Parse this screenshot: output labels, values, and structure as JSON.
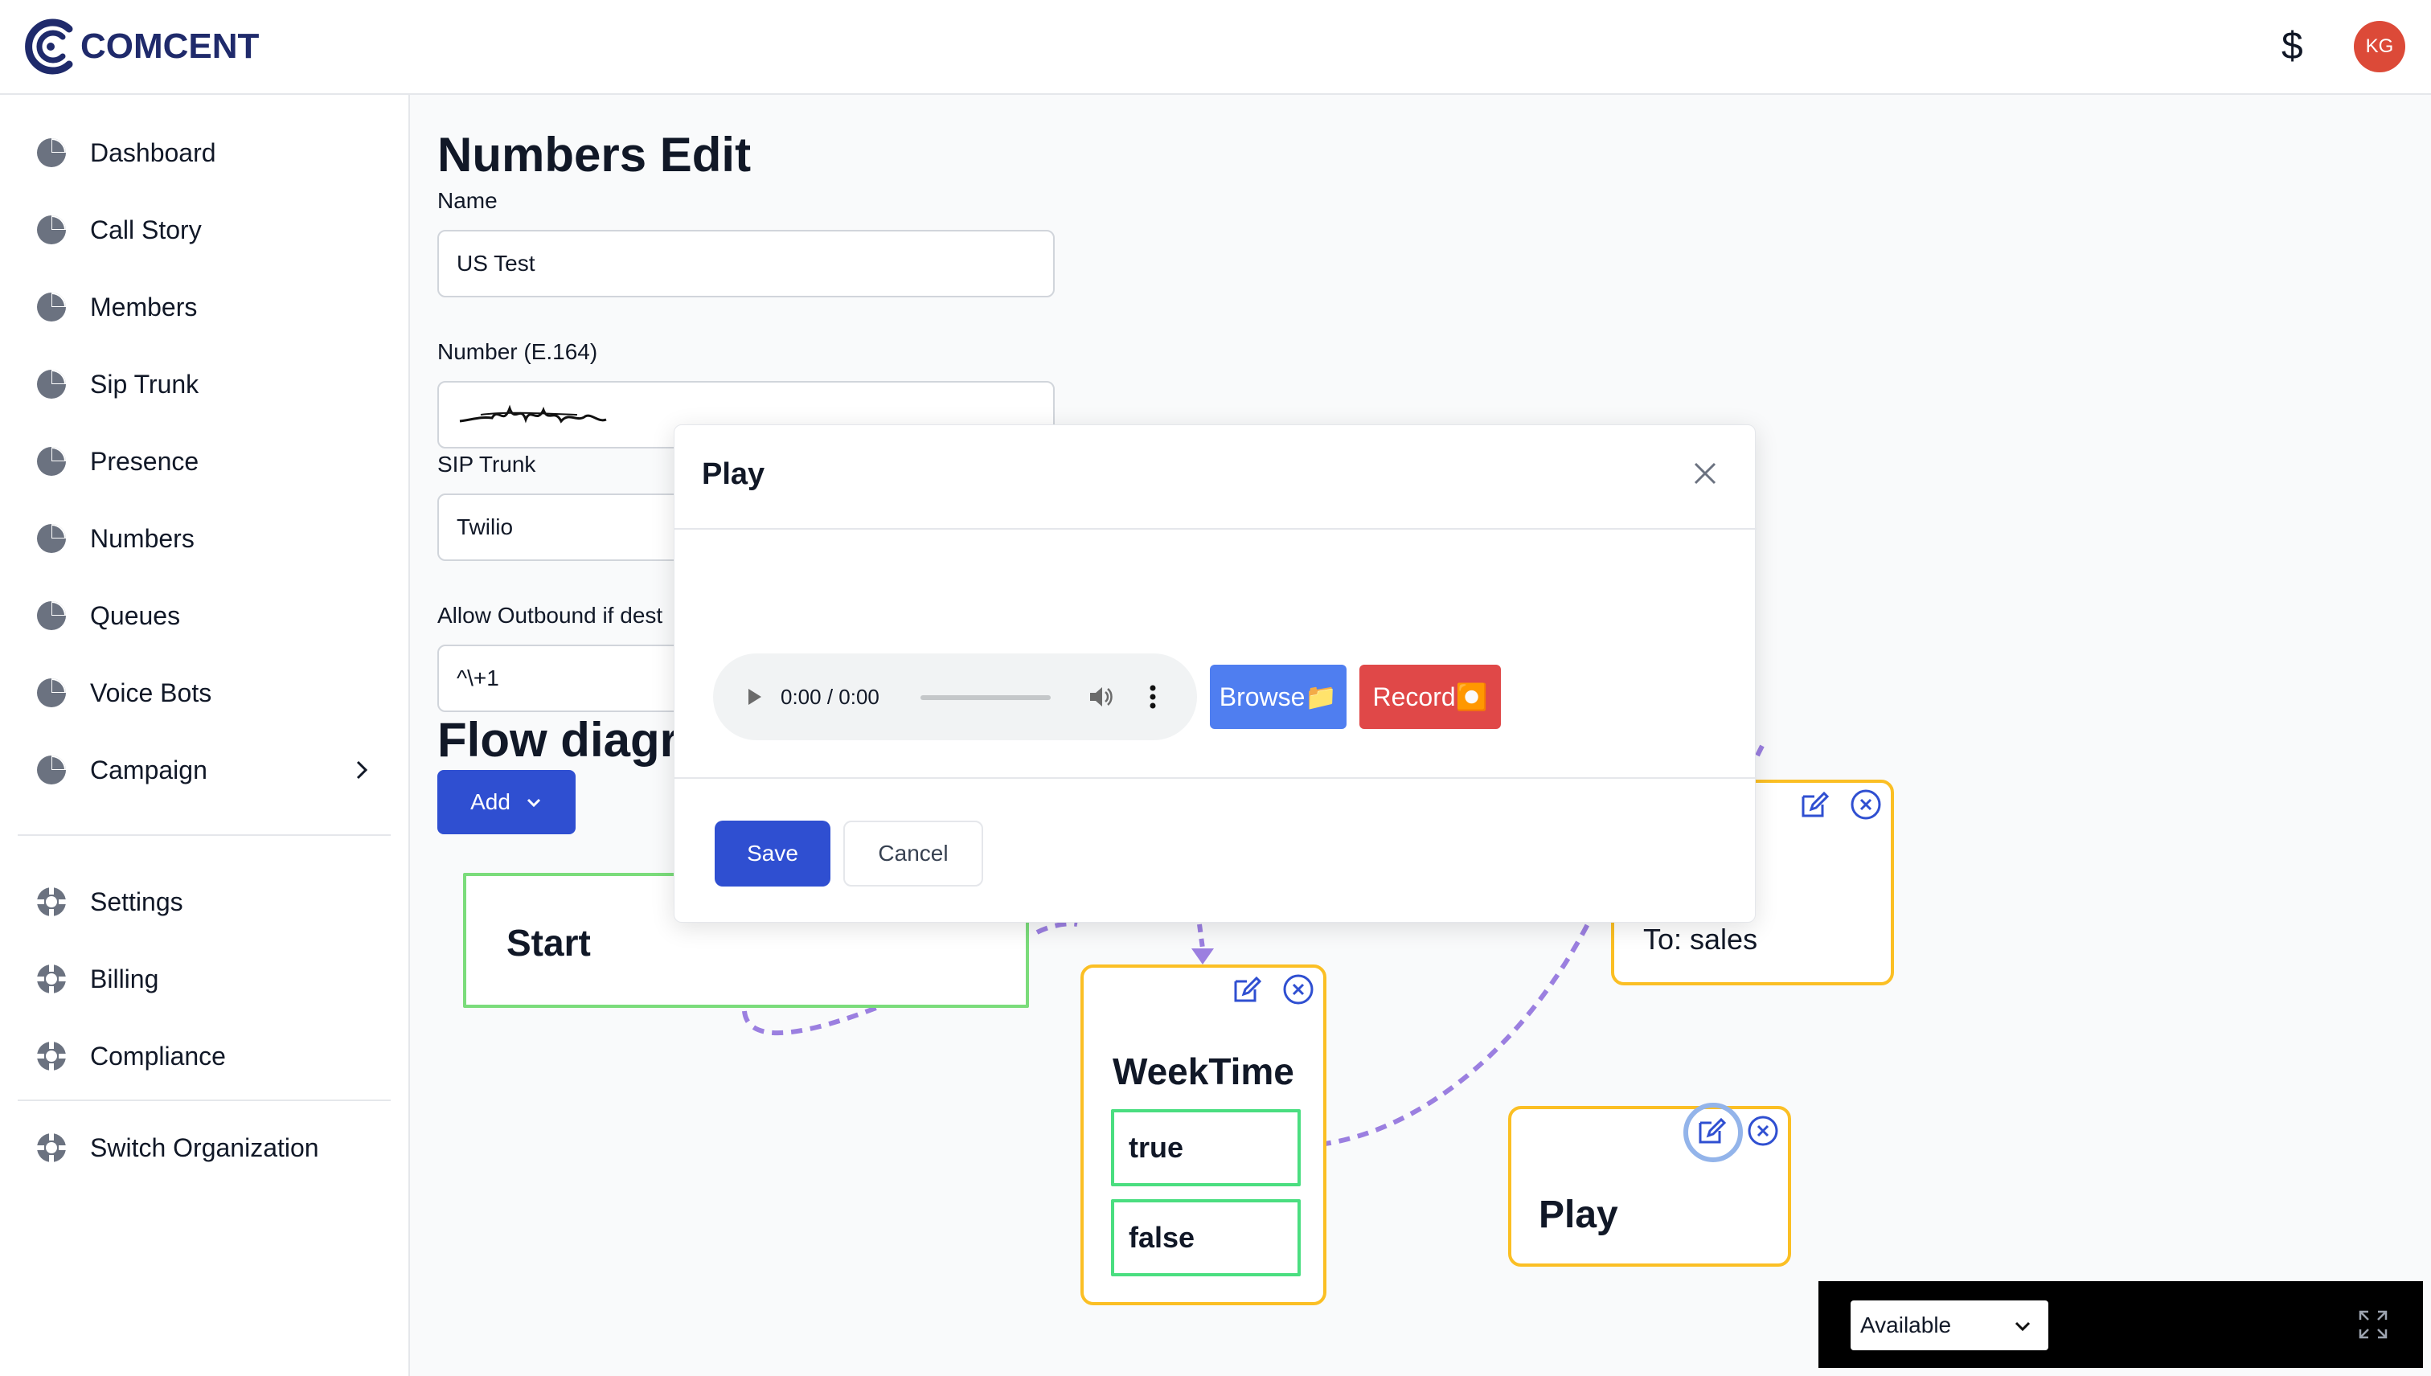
{
  "app": {
    "brand": "COMCENT",
    "currency_symbol": "$",
    "user_initials": "KG"
  },
  "sidebar": {
    "items": [
      {
        "label": "Dashboard",
        "icon": "pie-chart-icon"
      },
      {
        "label": "Call Story",
        "icon": "pie-chart-icon"
      },
      {
        "label": "Members",
        "icon": "pie-chart-icon"
      },
      {
        "label": "Sip Trunk",
        "icon": "pie-chart-icon"
      },
      {
        "label": "Presence",
        "icon": "pie-chart-icon"
      },
      {
        "label": "Numbers",
        "icon": "pie-chart-icon"
      },
      {
        "label": "Queues",
        "icon": "pie-chart-icon"
      },
      {
        "label": "Voice Bots",
        "icon": "pie-chart-icon"
      },
      {
        "label": "Campaign",
        "icon": "pie-chart-icon"
      }
    ],
    "secondary": [
      {
        "label": "Settings",
        "icon": "lifebuoy-icon"
      },
      {
        "label": "Billing",
        "icon": "lifebuoy-icon"
      },
      {
        "label": "Compliance",
        "icon": "lifebuoy-icon"
      }
    ],
    "tertiary": [
      {
        "label": "Switch Organization",
        "icon": "lifebuoy-icon"
      }
    ]
  },
  "form": {
    "title": "Numbers Edit",
    "name_label": "Name",
    "name_value": "US Test",
    "number_label": "Number (E.164)",
    "sip_label": "SIP Trunk",
    "sip_value": "Twilio",
    "outbound_label": "Allow Outbound if dest",
    "outbound_value": "^\\+1",
    "flow_title": "Flow diagra",
    "add_label": "Add"
  },
  "flow": {
    "start_label": "Start",
    "weektime_label": "WeekTime",
    "true_label": "true",
    "false_label": "false",
    "route_text": "To: sales",
    "play_label": "Play"
  },
  "modal": {
    "title": "Play",
    "audio_time": "0:00 / 0:00",
    "browse_label": "Browse📁",
    "record_label": "Record⏺️",
    "save_label": "Save",
    "cancel_label": "Cancel"
  },
  "status": {
    "value": "Available"
  },
  "colors": {
    "primary": "#2f4fd1",
    "browse": "#4f7ef0",
    "record": "#e04848",
    "node_border": "#fbbf24",
    "start_border": "#7bdc7b",
    "edge": "#9b7fe0"
  }
}
